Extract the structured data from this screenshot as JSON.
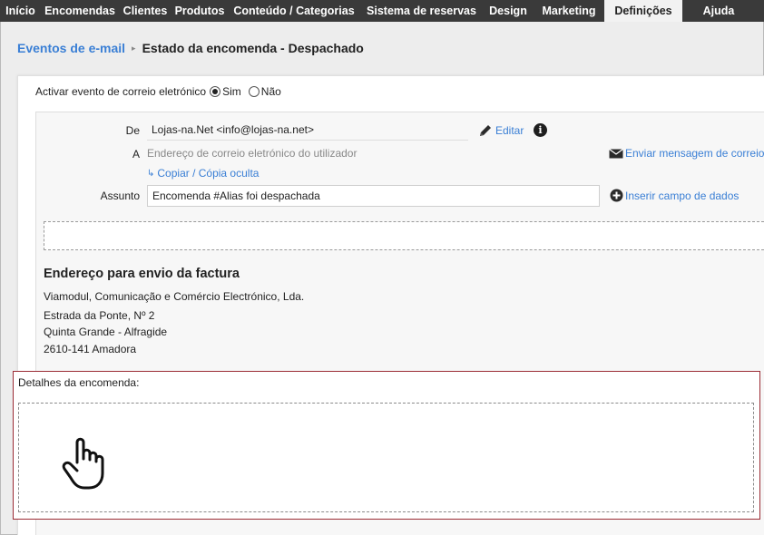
{
  "nav": {
    "items": [
      {
        "label": "Início",
        "w": 45
      },
      {
        "label": "Encomendas",
        "w": 86
      },
      {
        "label": "Clientes",
        "w": 58
      },
      {
        "label": "Produtos",
        "w": 62
      },
      {
        "label": "Conteúdo / Categorias",
        "w": 146
      },
      {
        "label": "Sistema de reservas",
        "w": 135
      },
      {
        "label": "Design",
        "w": 56
      },
      {
        "label": "Marketing",
        "w": 78
      },
      {
        "label": "Definições",
        "w": 86
      },
      {
        "label": "Ajuda",
        "w": 80
      }
    ],
    "active": "Definições"
  },
  "breadcrumb": {
    "parent": "Eventos de e-mail",
    "separator": "▸",
    "current": "Estado da encomenda - Despachado"
  },
  "activate": {
    "label": "Activar evento de correio eletrónico",
    "yes_label": "Sim",
    "no_label": "Não",
    "selected": "Sim"
  },
  "email": {
    "from_label": "De",
    "from_value": "Lojas-na.Net <info@lojas-na.net>",
    "edit_label": "Editar",
    "to_label": "A",
    "to_placeholder": "Endereço de correio eletrónico do utilizador",
    "send_label": "Enviar mensagem de correio",
    "cc_label": "Copiar / Cópia oculta",
    "subject_label": "Assunto",
    "subject_value": "Encomenda #Alias foi despachada",
    "insert_label": "Inserir campo de dados"
  },
  "billing": {
    "title": "Endereço para envio da factura",
    "company": "Viamodul, Comunicação e Comércio Electrónico, Lda.",
    "street": "Estrada da Ponte, Nº 2",
    "area": "Quinta Grande - Alfragide",
    "postal": "2610-141 Amadora"
  },
  "order": {
    "label": "Detalhes da encomenda:"
  },
  "colors": {
    "nav_bg": "#3a3a3a",
    "link": "#3a7fd5",
    "order_border": "#9b2b34"
  },
  "icons": [
    "pencil-icon",
    "info-icon",
    "envelope-icon",
    "plus-circle-icon",
    "arrow-right-icon",
    "hand-pointer-icon"
  ]
}
